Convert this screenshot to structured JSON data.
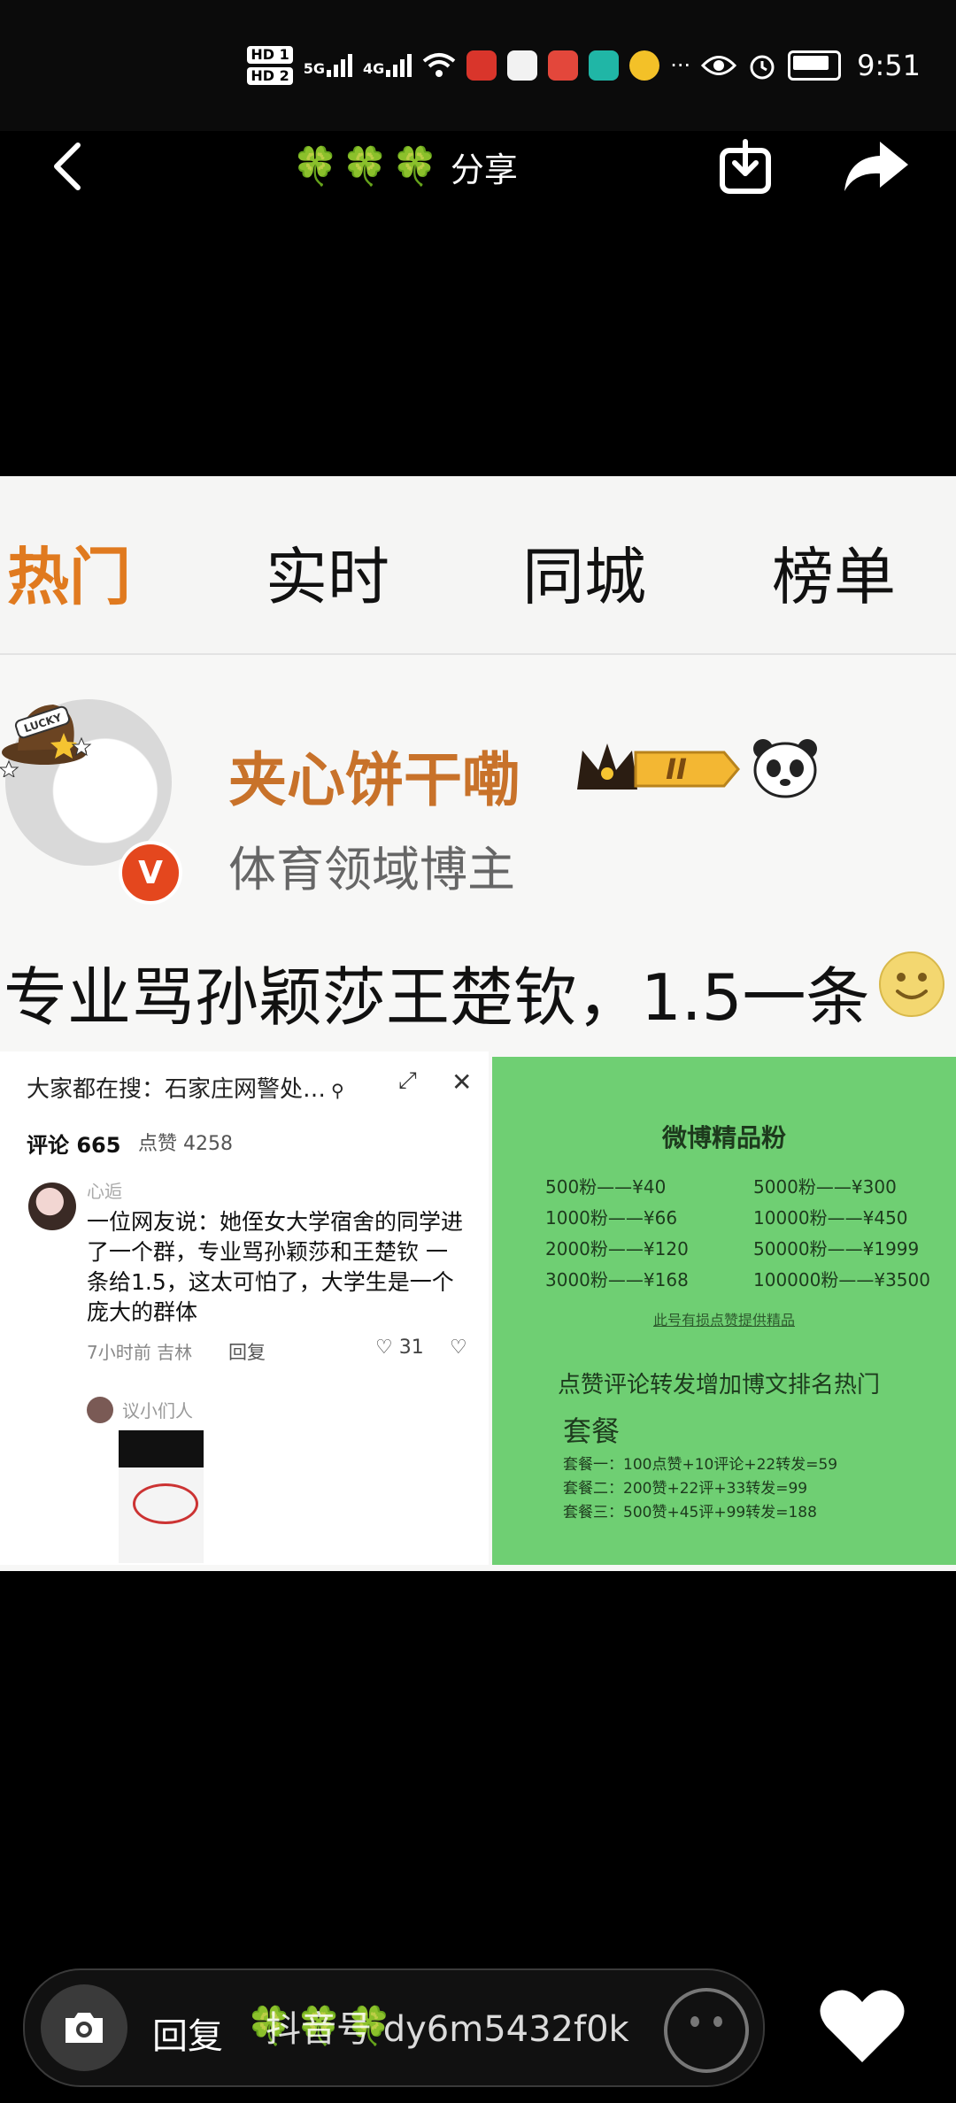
{
  "status_bar": {
    "sim1": "HD 1",
    "sim2": "HD 2",
    "net1": "5G",
    "net2": "4G",
    "more": "···",
    "time": "9:51"
  },
  "header": {
    "clovers": "🍀🍀🍀",
    "title": "分享"
  },
  "post": {
    "tabs": [
      "热门",
      "实时",
      "同城",
      "榜单"
    ],
    "username": "夹心饼干嘞",
    "user_desc": "体育领域博主",
    "level": "II",
    "v_badge": "V",
    "lucky": "LUCKY",
    "headline": "专业骂孙颖莎王楚钦，1.5一条",
    "left_card": {
      "search": "大家都在搜：石家庄网警处…",
      "comments_tab": "评论 665",
      "likes_tab": "点赞 4258",
      "commenter": "心逅",
      "comment_text": "一位网友说：她侄女大学宿舍的同学进了一个群，专业骂孙颖莎和王楚钦 一条给1.5，这太可怕了，大学生是一个庞大的群体",
      "time": "7小时前 吉林",
      "reply": "回复",
      "like_count": "♡ 31",
      "reply_name": "议小们人"
    },
    "right_card": {
      "title": "微博精品粉",
      "prices": [
        "500粉——¥40",
        "5000粉——¥300",
        "1000粉——¥66",
        "10000粉——¥450",
        "2000粉——¥120",
        "50000粉——¥1999",
        "3000粉——¥168",
        "100000粉——¥3500"
      ],
      "note": "此号有损点赞提供精品",
      "headline": "点赞评论转发增加博文排名热门",
      "package_title": "套餐",
      "items": [
        "套餐一：100点赞+10评论+22转发=59",
        "套餐二：200赞+22评+33转发=99",
        "套餐三：500赞+45评+99转发=188"
      ]
    }
  },
  "bottom": {
    "reply_label": "回复",
    "clovers": "🍀🍀🍀",
    "watermark": "抖音号 dy6m5432f0k"
  },
  "colors": {
    "tab_active": "#e07a1f",
    "username": "#c8722a",
    "price_card": "#6fcf73",
    "clover": "#4caf2f"
  }
}
